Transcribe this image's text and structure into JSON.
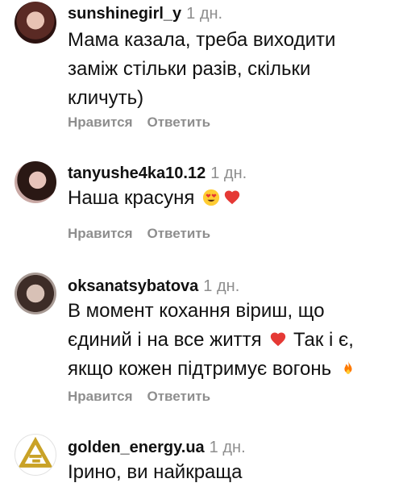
{
  "comments": [
    {
      "username": "sunshinegirl_y",
      "time": "1 дн.",
      "lines": [
        "Мама казала, треба виходити",
        "заміж стільки разів, скільки",
        "кличуть)"
      ],
      "like_label": "Нравится",
      "reply_label": "Ответить"
    },
    {
      "username": "tanyushe4ka10.12",
      "time": "1 дн.",
      "lines": [
        "Наша красуня"
      ],
      "like_label": "Нравится",
      "reply_label": "Ответить"
    },
    {
      "username": "oksanatsybatova",
      "time": "1 дн.",
      "lines": [
        "В момент кохання віриш, що",
        "єдиний і на все життя",
        "Так і є,",
        "якщо кожен підтримує вогонь"
      ],
      "like_label": "Нравится",
      "reply_label": "Ответить"
    },
    {
      "username": "golden_energy.ua",
      "time": "1 дн.",
      "lines": [
        "Ірино, ви найкраща"
      ]
    }
  ],
  "colors": {
    "heart": "#e53935",
    "flame": "#ff7a00",
    "smiley": "#ffcc33",
    "logo": "#c9a227"
  }
}
